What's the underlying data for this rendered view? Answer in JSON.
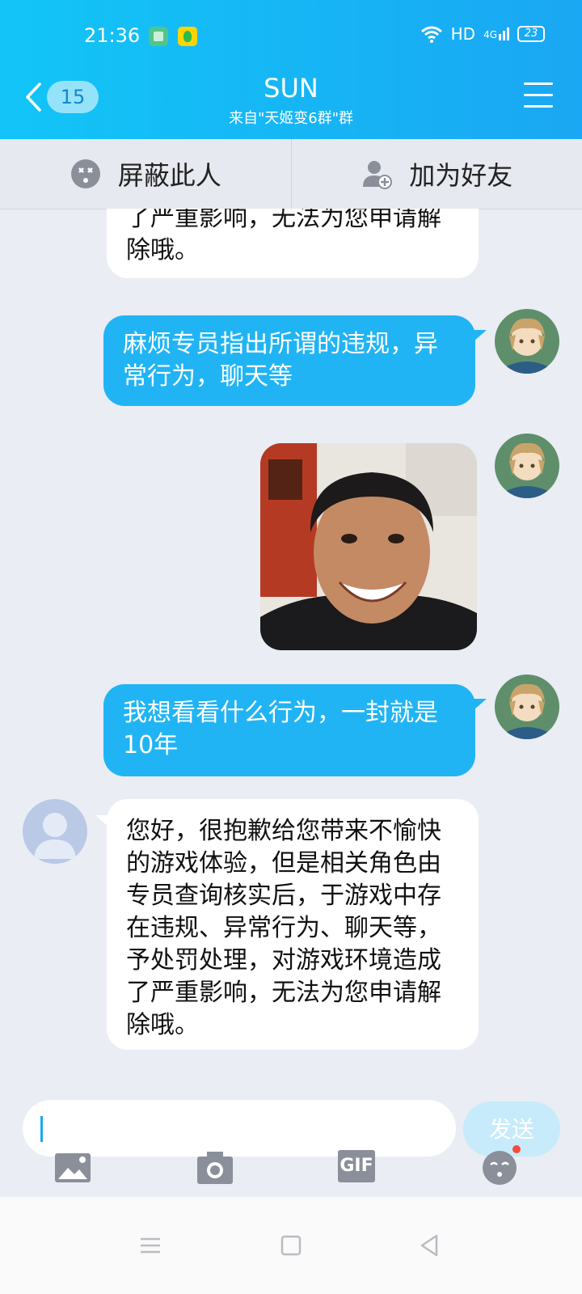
{
  "status": {
    "time": "21:36",
    "network": "HD",
    "signal": "4G",
    "battery": "23"
  },
  "header": {
    "back_count": "15",
    "title": "SUN",
    "subtitle": "来自\"天姬变6群\"群"
  },
  "actions": {
    "block_label": "屏蔽此人",
    "add_friend_label": "加为好友"
  },
  "messages": [
    {
      "side": "in",
      "text": "了严重影响，无法为您申请解除哦。"
    },
    {
      "side": "out",
      "text": "麻烦专员指出所谓的违规，异常行为，聊天等"
    },
    {
      "side": "out",
      "type": "image",
      "alt": ""
    },
    {
      "side": "out",
      "text": "我想看看什么行为，一封就是10年"
    },
    {
      "side": "in",
      "text": "您好，很抱歉给您带来不愉快的游戏体验，但是相关角色由专员查询核实后，于游戏中存在违规、异常行为、聊天等，予处罚处理，对游戏环境造成了严重影响，无法为您申请解除哦。"
    }
  ],
  "input": {
    "value": "",
    "placeholder": ""
  },
  "send_label": "发送",
  "toolbar": {
    "gif_label": "GIF"
  },
  "colors": {
    "header": "#1aa7f3",
    "bubble_out": "#21b4f5",
    "send_disabled": "#c7ebfb",
    "background": "#eaedf4"
  }
}
